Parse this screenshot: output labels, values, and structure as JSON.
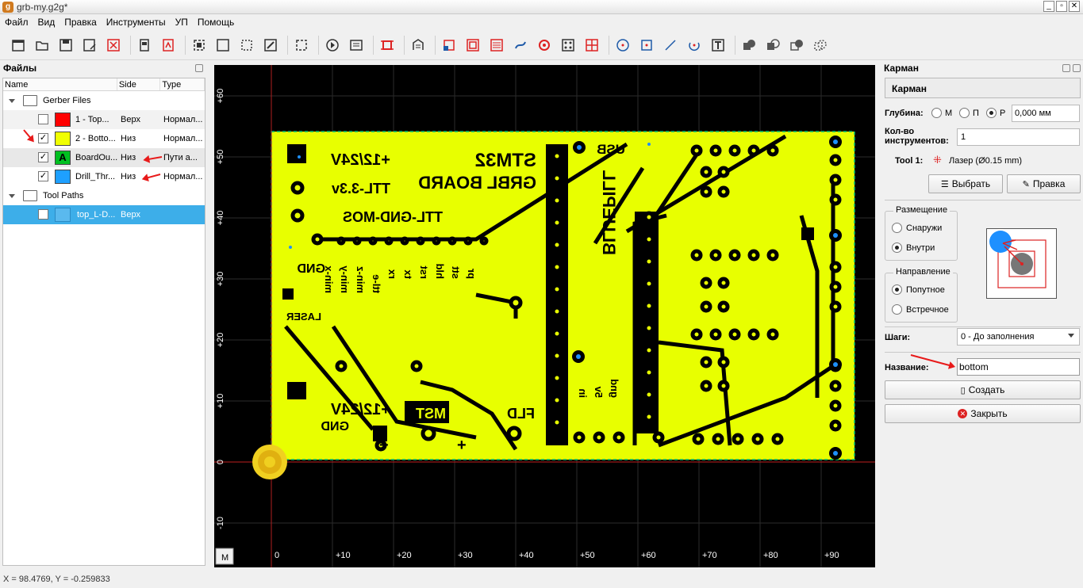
{
  "window": {
    "title": "grb-my.g2g*",
    "app_icon_letter": "g"
  },
  "menu": [
    "Файл",
    "Вид",
    "Правка",
    "Инструменты",
    "УП",
    "Помощь"
  ],
  "files_panel": {
    "title": "Файлы",
    "columns": [
      "Name",
      "Side",
      "Type"
    ],
    "groups": [
      {
        "label": "Gerber Files"
      },
      {
        "label": "Tool Paths"
      }
    ],
    "files": [
      {
        "name": "1 - Top...",
        "side": "Верх",
        "type": "Нормал...",
        "checked": false,
        "color": "#ff0000"
      },
      {
        "name": "2 - Botto...",
        "side": "Низ",
        "type": "Нормал...",
        "checked": true,
        "color": "#f0ff00"
      },
      {
        "name": "BoardOu...",
        "side": "Низ",
        "type": "Пути а...",
        "checked": true,
        "color": "#00c020",
        "letter": "A"
      },
      {
        "name": "Drill_Thr...",
        "side": "Низ",
        "type": "Нормал...",
        "checked": true,
        "color": "#1ea0ff"
      }
    ],
    "toolpaths": [
      {
        "name": "top_L-D...",
        "side": "Верх",
        "checked": false
      }
    ]
  },
  "canvas": {
    "y_ticks": [
      "+60",
      "+50",
      "+40",
      "+30",
      "+20",
      "+10",
      "0",
      "-10"
    ],
    "x_ticks": [
      "0",
      "+10",
      "+20",
      "+30",
      "+40",
      "+50",
      "+60",
      "+70",
      "+80",
      "+90"
    ],
    "corner_button": "M",
    "board_texts": {
      "stm32": "STM32",
      "grbl": "GRBL BOARD",
      "usb": "USB",
      "v1224_top": "+12/24V",
      "ttl33": "TTL-3.3v",
      "ttlgnd": "TTL-GND-MOS",
      "gnd_left": "GND",
      "laser": "LASER",
      "bluepill": "BLUEPILL",
      "v1224_bot": "+12/24V",
      "gnd_bot": "GND",
      "mst": "MST",
      "fld": "FLD",
      "pins": [
        "min-x",
        "min-y",
        "min-z",
        "ttl-e",
        "rx",
        "tx",
        "rst",
        "hld",
        "stt",
        "pr"
      ],
      "pwr": [
        "5v",
        "gnd",
        "in"
      ]
    }
  },
  "status": "X = 98.4769, Y = -0.259833",
  "pocket_panel": {
    "panel_title": "Карман",
    "header": "Карман",
    "depth_label": "Глубина:",
    "depth_options": [
      "М",
      "П",
      "Р"
    ],
    "depth_value": "0,000 мм",
    "tools_label": "Кол-во инструментов:",
    "tools_count": "1",
    "tool1_label": "Tool 1:",
    "tool1_value": "Лазер (Ø0.15 mm)",
    "select_button": "Выбрать",
    "edit_button": "Правка",
    "placement": {
      "title": "Размещение",
      "options": [
        "Снаружи",
        "Внутри"
      ],
      "selected": "Внутри"
    },
    "direction": {
      "title": "Направление",
      "options": [
        "Попутное",
        "Встречное"
      ],
      "selected": "Попутное"
    },
    "steps_label": "Шаги:",
    "steps_value": "0 - До заполнения",
    "name_label": "Название:",
    "name_value": "bottom",
    "create_button": "Создать",
    "close_button": "Закрыть"
  }
}
